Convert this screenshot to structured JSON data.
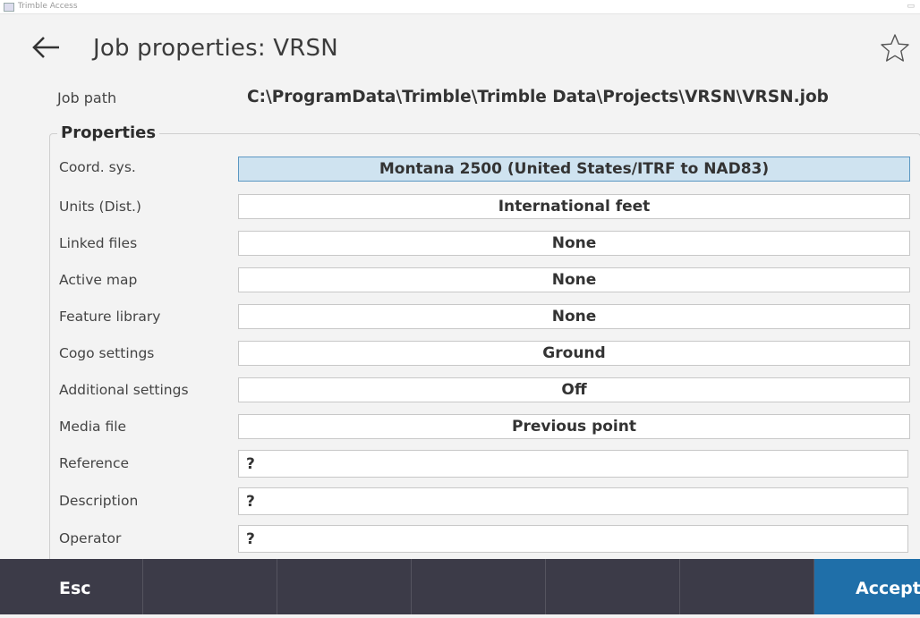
{
  "window": {
    "app_name": "Trimble Access",
    "control_glyph": "▭"
  },
  "header": {
    "title": "Job properties:  VRSN",
    "back_icon": "arrow-left-icon",
    "favorite_icon": "star-outline-icon"
  },
  "job_path": {
    "label": "Job path",
    "value": "C:\\ProgramData\\Trimble\\Trimble Data\\Projects\\VRSN\\VRSN.job"
  },
  "properties": {
    "legend": "Properties",
    "rows": [
      {
        "label": "Coord. sys.",
        "value": "Montana 2500 (United States/ITRF to NAD83)"
      },
      {
        "label": "Units (Dist.)",
        "value": "International feet"
      },
      {
        "label": "Linked files",
        "value": "None"
      },
      {
        "label": "Active map",
        "value": "None"
      },
      {
        "label": "Feature library",
        "value": "None"
      },
      {
        "label": "Cogo settings",
        "value": "Ground"
      },
      {
        "label": "Additional settings",
        "value": "Off"
      },
      {
        "label": "Media file",
        "value": "Previous point"
      }
    ],
    "inputs": [
      {
        "label": "Reference",
        "value": "?"
      },
      {
        "label": "Description",
        "value": "?"
      },
      {
        "label": "Operator",
        "value": "?"
      }
    ]
  },
  "softkeys": {
    "esc": "Esc",
    "accept": "Accept"
  },
  "colors": {
    "accent": "#1f6fa9",
    "softkey_bar": "#3c3b48",
    "selected_field": "#cfe3f0"
  }
}
